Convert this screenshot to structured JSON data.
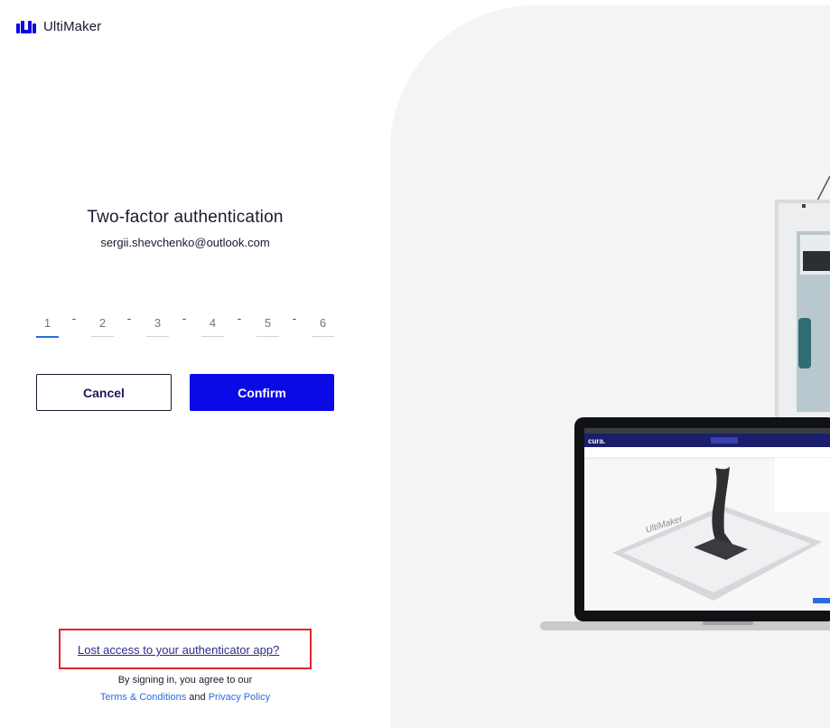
{
  "brand": {
    "name": "UltiMaker"
  },
  "auth": {
    "title": "Two-factor authentication",
    "email": "sergii.shevchenko@outlook.com",
    "digit_placeholders": [
      "1",
      "2",
      "3",
      "4",
      "5",
      "6"
    ],
    "separator": "-"
  },
  "actions": {
    "cancel_label": "Cancel",
    "confirm_label": "Confirm"
  },
  "footer": {
    "lost_access_link": "Lost access to your authenticator app?",
    "agree_text": "By signing in, you agree to our",
    "terms_link": "Terms & Conditions",
    "and_text": "and",
    "privacy_link": "Privacy Policy"
  },
  "illustration": {
    "printer_brand": "UltiMaker",
    "app_name": "cura."
  },
  "colors": {
    "primary": "#0a0ae6",
    "link": "#2b6cdf",
    "highlight": "#e0262c",
    "panel": "#f4f4f5"
  }
}
